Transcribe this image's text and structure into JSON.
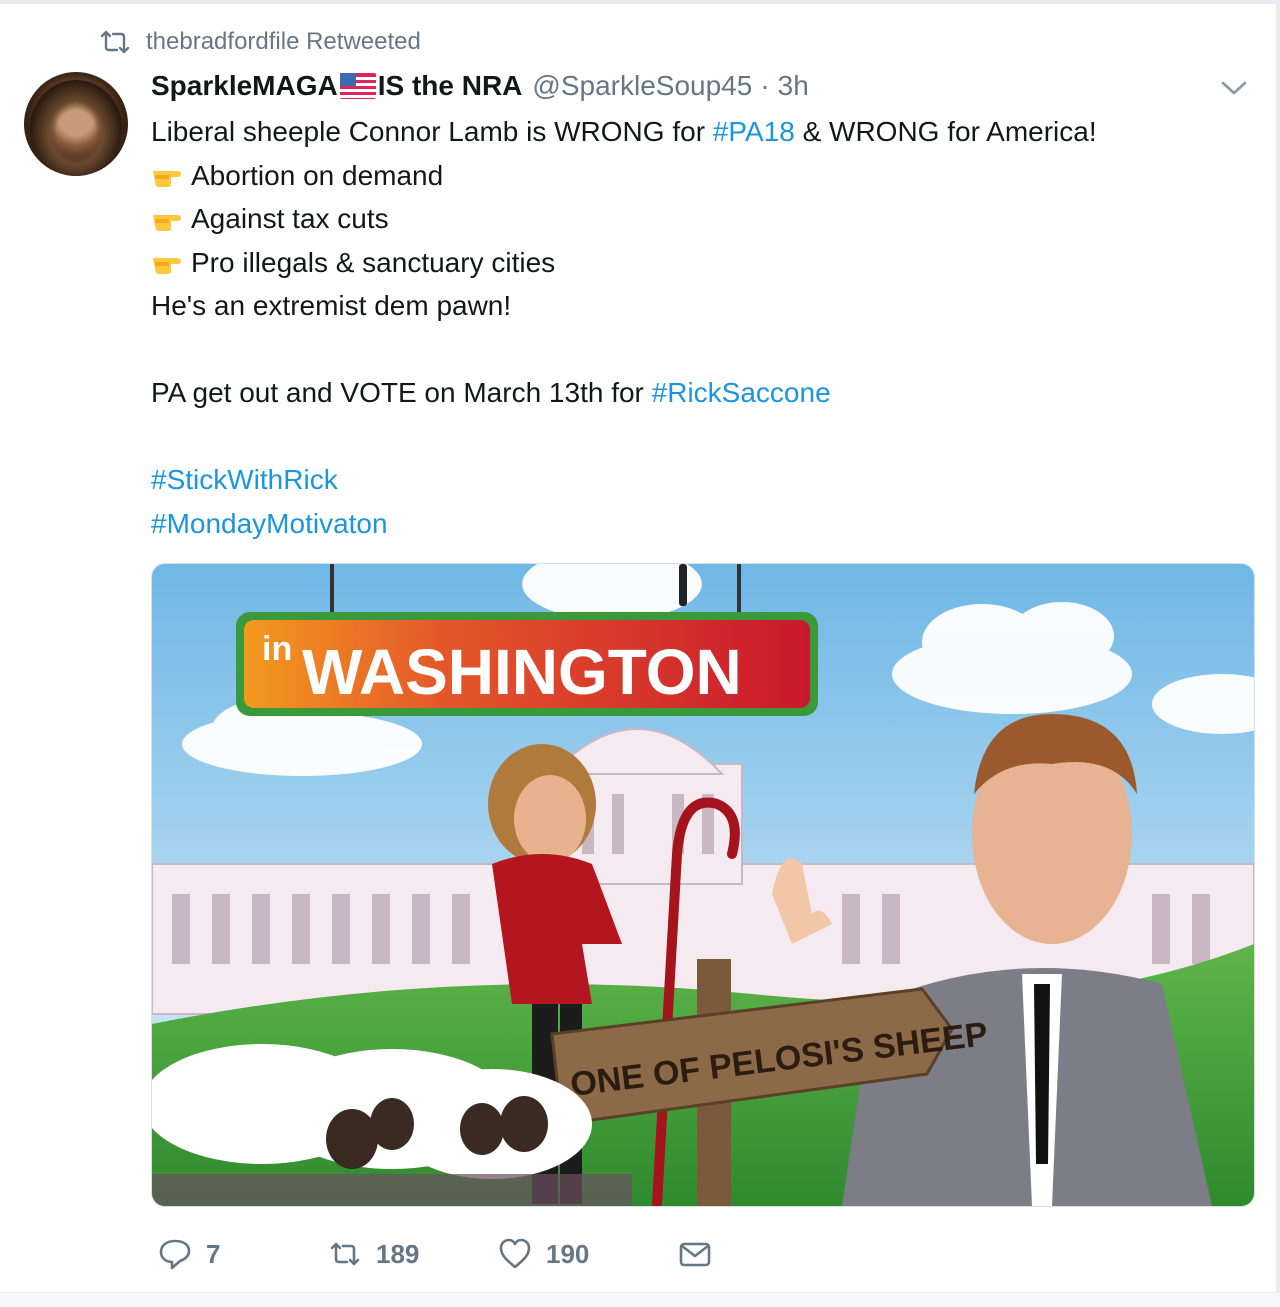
{
  "context": {
    "label": "thebradfordfile Retweeted"
  },
  "tweet": {
    "name_part1": "SparkleMAGA",
    "name_part2": "IS the NRA",
    "handle": "@SparkleSoup45",
    "separator": "·",
    "time": "3h",
    "lines": {
      "l1_pre": "Liberal sheeple Connor Lamb is WRONG for ",
      "l1_tag": "#PA18",
      "l1_post": " & WRONG for America!",
      "b1": "Abortion on demand",
      "b2": "Against tax cuts",
      "b3": "Pro illegals & sanctuary cities",
      "l5": "He's an extremist dem pawn!",
      "l6_pre": "PA get out and VOTE on March 13th for ",
      "l6_tag": "#RickSaccone",
      "tag1": "#StickWithRick",
      "tag2": "#MondayMotivaton"
    },
    "media": {
      "banner_small": "in",
      "banner_big": "WASHINGTON",
      "sign_text": "ONE OF PELOSI'S SHEEP"
    },
    "actions": {
      "replies": "7",
      "retweets": "189",
      "likes": "190"
    }
  },
  "colors": {
    "link": "#1b95e0",
    "muted": "#657786",
    "text": "#14171a"
  },
  "icons": [
    "retweet-icon",
    "chevron-down-icon",
    "us-flag-icon",
    "pointing-hand-icon",
    "reply-icon",
    "like-icon",
    "message-icon"
  ]
}
